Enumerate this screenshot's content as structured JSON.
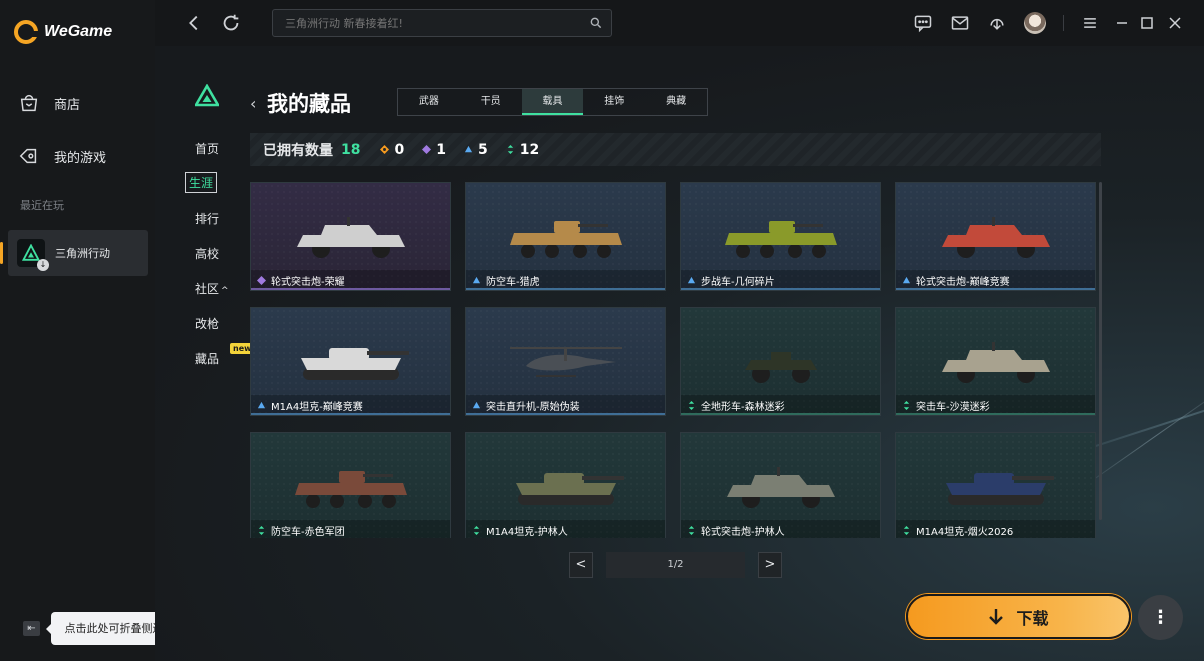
{
  "app": {
    "logo_text": "WeGame"
  },
  "sidebar": {
    "items": [
      {
        "label": "商店",
        "icon": "store-icon"
      },
      {
        "label": "我的游戏",
        "icon": "my-games-icon"
      }
    ],
    "recent_label": "最近在玩",
    "recent_game": "三角洲行动",
    "collapse_tooltip": "点击此处可折叠侧边栏"
  },
  "topbar": {
    "search_placeholder": "三角洲行动 新春接着红!"
  },
  "subnav": {
    "items": [
      "首页",
      "生涯",
      "排行",
      "高校",
      "社区",
      "改枪",
      "藏品"
    ],
    "community_suffix": "^",
    "active": "生涯",
    "new_badge": "new"
  },
  "page": {
    "title": "我的藏品",
    "tabs": [
      "武器",
      "干员",
      "载具",
      "挂饰",
      "典藏"
    ],
    "active_tab": "载具"
  },
  "counts": {
    "label": "已拥有数量",
    "total": "18",
    "orange": "0",
    "purple": "1",
    "blue": "5",
    "green": "12"
  },
  "colors": {
    "accent": "#3fe0a0",
    "orange": "#f59a1f",
    "purple": "#a07ae0",
    "blue": "#5aa9f0",
    "green": "#3fe0a0"
  },
  "items": [
    {
      "name": "轮式突击炮-荣耀",
      "rarity": "purple"
    },
    {
      "name": "防空车-猎虎",
      "rarity": "blue"
    },
    {
      "name": "步战车-几何碎片",
      "rarity": "blue"
    },
    {
      "name": "轮式突击炮-巅峰竞赛",
      "rarity": "blue"
    },
    {
      "name": "M1A4坦克-巅峰竞赛",
      "rarity": "blue"
    },
    {
      "name": "突击直升机-原始伪装",
      "rarity": "blue"
    },
    {
      "name": "全地形车-森林迷彩",
      "rarity": "green"
    },
    {
      "name": "突击车-沙漠迷彩",
      "rarity": "green"
    },
    {
      "name": "防空车-赤色军团",
      "rarity": "green"
    },
    {
      "name": "M1A4坦克-护林人",
      "rarity": "green"
    },
    {
      "name": "轮式突击炮-护林人",
      "rarity": "green"
    },
    {
      "name": "M1A4坦克-烟火2026",
      "rarity": "green"
    }
  ],
  "pagination": {
    "text": "1/2",
    "prev": "<",
    "next": ">"
  },
  "actions": {
    "download_label": "下载",
    "more_label": "⋮"
  }
}
